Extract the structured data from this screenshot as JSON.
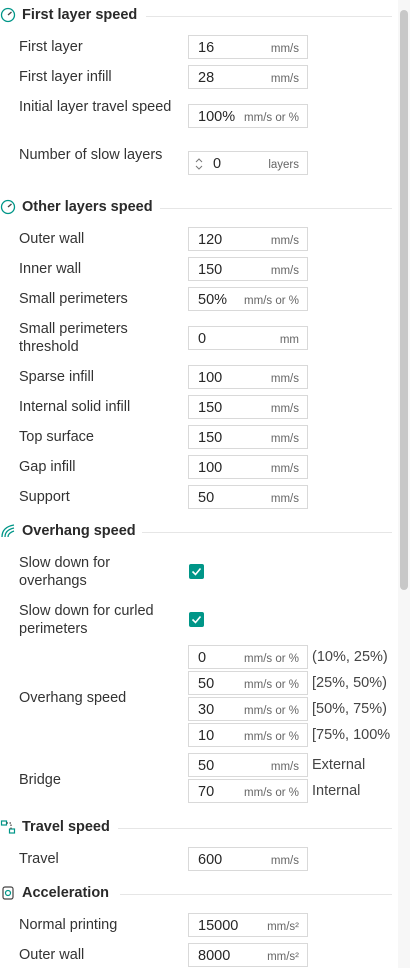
{
  "sections": {
    "first_layer_speed": {
      "title": "First layer speed",
      "icon": "speedometer-icon",
      "rows": {
        "first_layer": {
          "label": "First layer",
          "value": "16",
          "unit": "mm/s"
        },
        "first_layer_infill": {
          "label": "First layer infill",
          "value": "28",
          "unit": "mm/s"
        },
        "initial_layer_travel": {
          "label": "Initial layer travel speed",
          "value": "100%",
          "unit": "mm/s or %"
        },
        "slow_layers": {
          "label": "Number of slow layers",
          "value": "0",
          "unit": "layers"
        }
      }
    },
    "other_layers_speed": {
      "title": "Other layers speed",
      "icon": "speedometer-icon",
      "rows": {
        "outer_wall": {
          "label": "Outer wall",
          "value": "120",
          "unit": "mm/s"
        },
        "inner_wall": {
          "label": "Inner wall",
          "value": "150",
          "unit": "mm/s"
        },
        "small_perimeters": {
          "label": "Small perimeters",
          "value": "50%",
          "unit": "mm/s or %"
        },
        "small_perimeters_threshold": {
          "label": "Small perimeters threshold",
          "value": "0",
          "unit": "mm"
        },
        "sparse_infill": {
          "label": "Sparse infill",
          "value": "100",
          "unit": "mm/s"
        },
        "internal_solid_infill": {
          "label": "Internal solid infill",
          "value": "150",
          "unit": "mm/s"
        },
        "top_surface": {
          "label": "Top surface",
          "value": "150",
          "unit": "mm/s"
        },
        "gap_infill": {
          "label": "Gap infill",
          "value": "100",
          "unit": "mm/s"
        },
        "support": {
          "label": "Support",
          "value": "50",
          "unit": "mm/s"
        }
      }
    },
    "overhang_speed": {
      "title": "Overhang speed",
      "icon": "overhang-icon",
      "slow_overhangs": {
        "label": "Slow down for overhangs",
        "checked": true
      },
      "slow_curled": {
        "label": "Slow down for curled perimeters",
        "checked": true
      },
      "overhang_label": "Overhang speed",
      "overhang_rows": [
        {
          "value": "0",
          "unit": "mm/s or %",
          "range": "(10%, 25%)"
        },
        {
          "value": "50",
          "unit": "mm/s or %",
          "range": "[25%, 50%)"
        },
        {
          "value": "30",
          "unit": "mm/s or %",
          "range": "[50%, 75%)"
        },
        {
          "value": "10",
          "unit": "mm/s or %",
          "range": "[75%, 100%"
        }
      ],
      "bridge_label": "Bridge",
      "bridge_rows": [
        {
          "value": "50",
          "unit": "mm/s",
          "range": "External"
        },
        {
          "value": "70",
          "unit": "mm/s or %",
          "range": "Internal"
        }
      ]
    },
    "travel_speed": {
      "title": "Travel speed",
      "icon": "travel-icon",
      "rows": {
        "travel": {
          "label": "Travel",
          "value": "600",
          "unit": "mm/s"
        }
      }
    },
    "acceleration": {
      "title": "Acceleration",
      "icon": "acceleration-icon",
      "rows": {
        "normal_printing": {
          "label": "Normal printing",
          "value": "15000",
          "unit": "mm/s²"
        },
        "outer_wall": {
          "label": "Outer wall",
          "value": "8000",
          "unit": "mm/s²"
        }
      }
    }
  },
  "colors": {
    "accent": "#009688",
    "border": "#d9d9d9",
    "text": "#262626"
  }
}
